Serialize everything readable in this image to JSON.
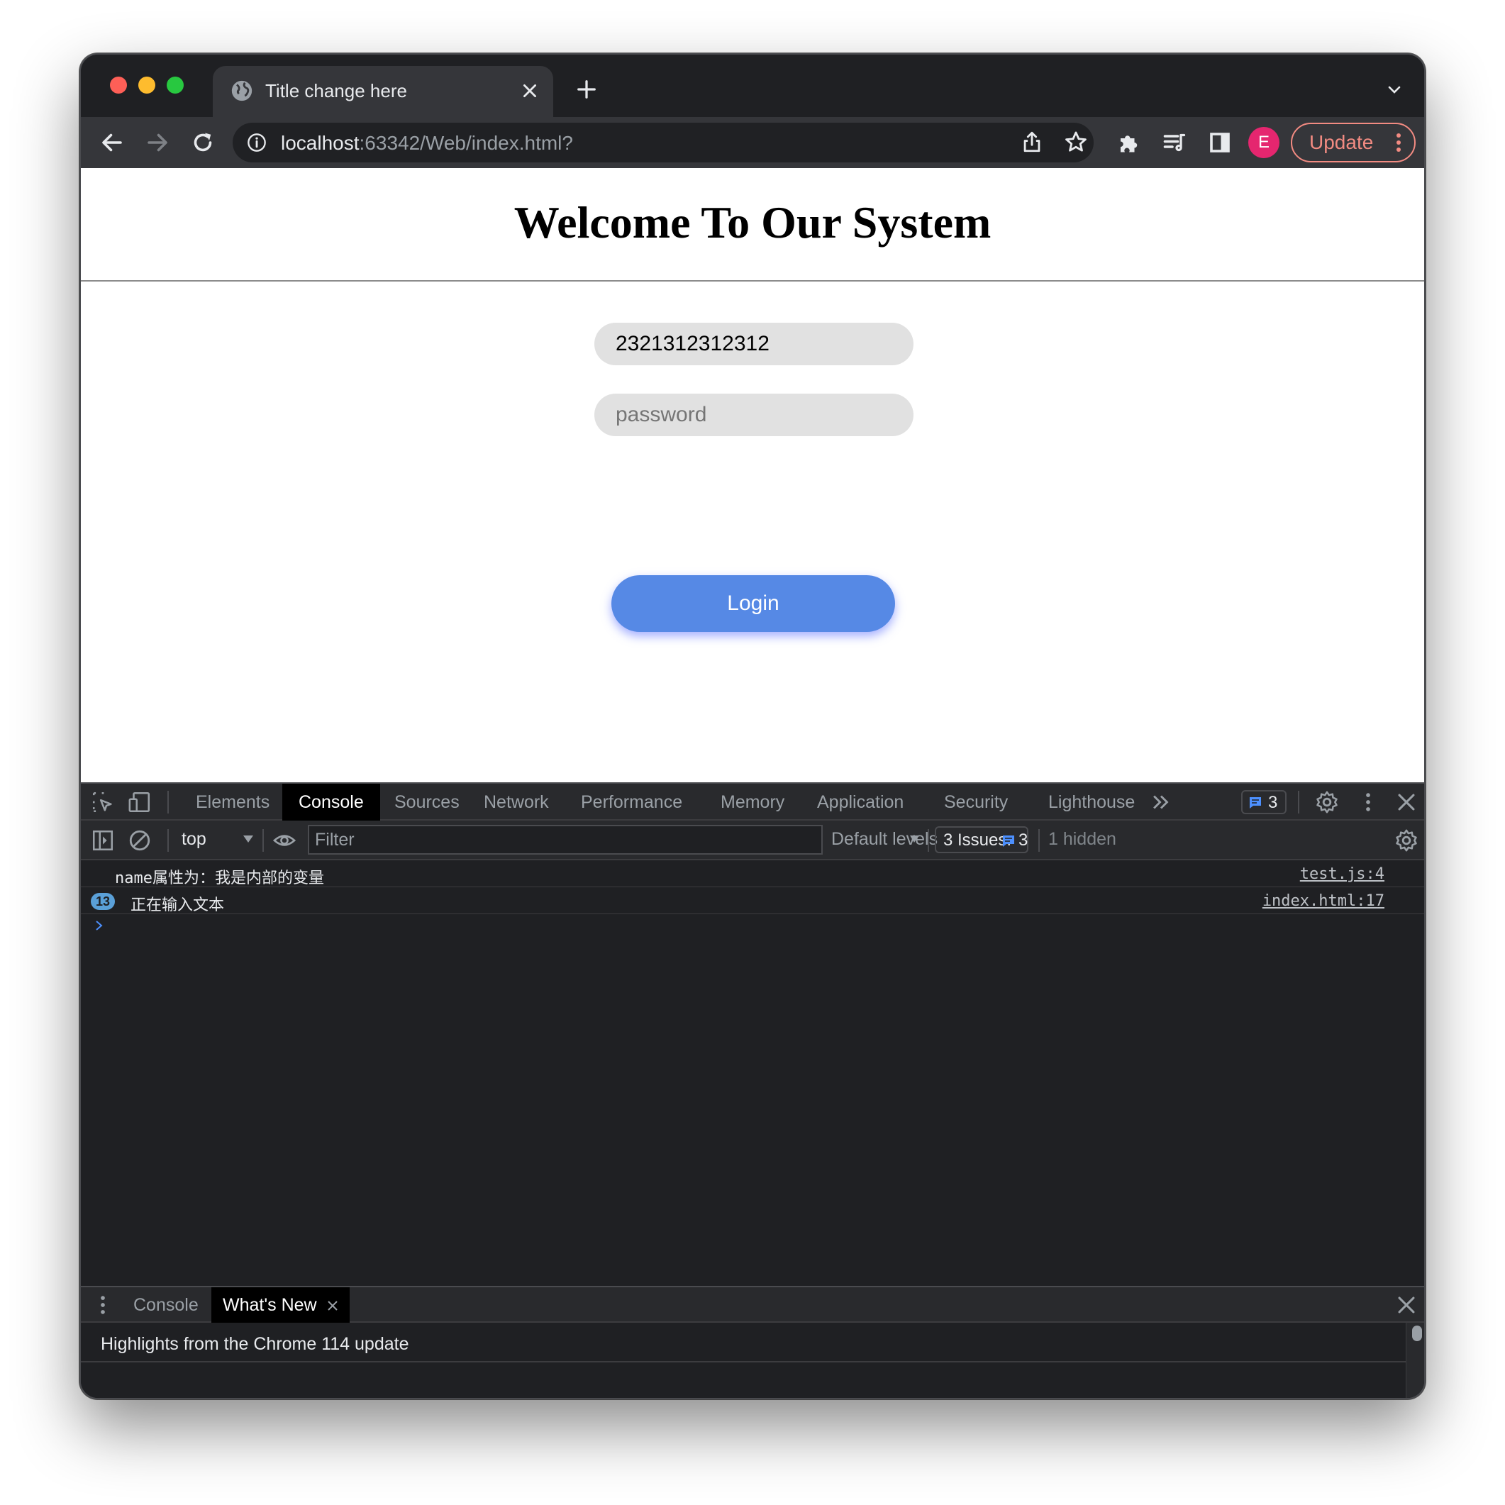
{
  "browser": {
    "tab": {
      "title": "Title change here"
    },
    "toolbar": {
      "url_host": "localhost",
      "url_rest": ":63342/Web/index.html?",
      "profile_initial": "E",
      "update_label": "Update"
    }
  },
  "page": {
    "heading": "Welcome To Our System",
    "username_value": "2321312312312",
    "password_placeholder": "password",
    "login_label": "Login",
    "accent_color": "#5689e5"
  },
  "devtools": {
    "tabs": [
      "Elements",
      "Console",
      "Sources",
      "Network",
      "Performance",
      "Memory",
      "Application",
      "Security",
      "Lighthouse"
    ],
    "active_tab": "Console",
    "message_badge_count": "3",
    "context": "top",
    "filter_placeholder": "Filter",
    "levels_label": "Default levels",
    "issues_label": "3 Issues:",
    "issues_count": "3",
    "hidden_label": "1 hidden",
    "console_messages": [
      {
        "text": "name属性为：我是内部的变量",
        "source": "test.js:4",
        "repeat": ""
      },
      {
        "text": "正在输入文本",
        "source": "index.html:17",
        "repeat": "13"
      }
    ],
    "drawer": {
      "tabs": [
        "Console",
        "What's New"
      ],
      "active_tab": "What's New",
      "highlight_text": "Highlights from the Chrome 114 update"
    }
  }
}
